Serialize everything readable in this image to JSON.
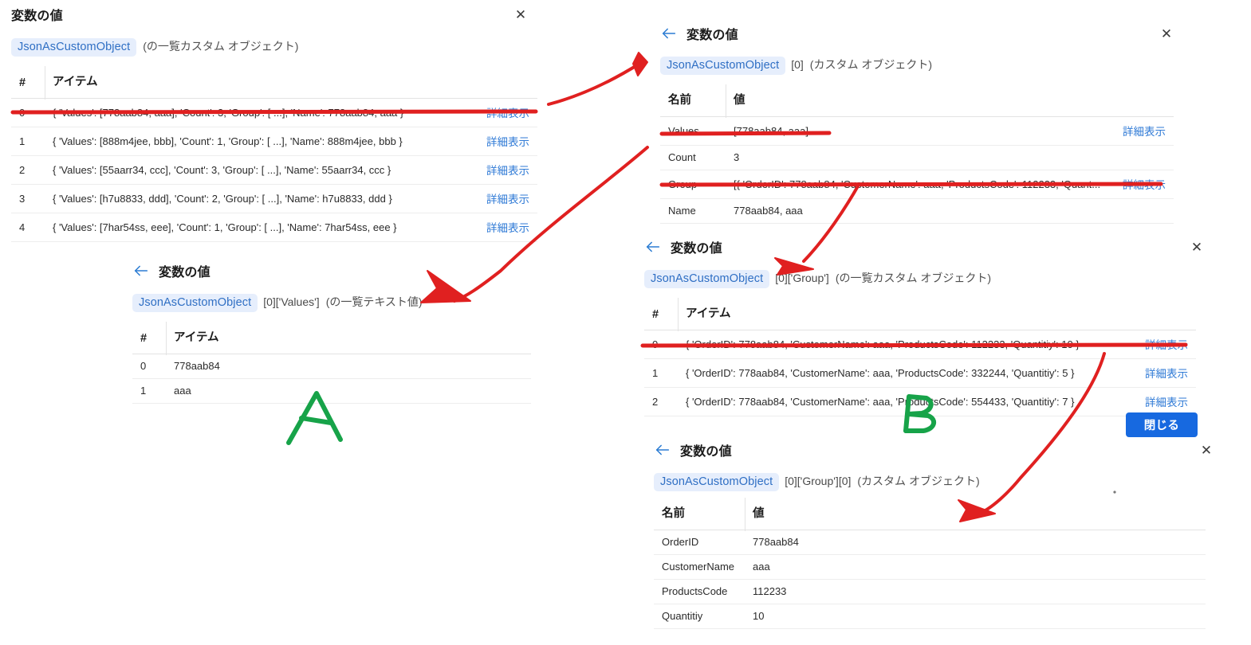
{
  "common": {
    "title": "変数の値",
    "detail_link": "詳細表示",
    "col_index": "#",
    "col_item": "アイテム",
    "col_name": "名前",
    "col_value": "値",
    "close_icon": "✕",
    "back_icon": "back-arrow-icon",
    "accent_blue": "#2f7ad6",
    "pill_bg": "#e6eefc",
    "pill_text": "#2f6fc4",
    "button_blue": "#1769e0",
    "annotation_red": "#e02020",
    "annotation_green": "#17a349"
  },
  "panel1": {
    "title": "変数の値",
    "variable": "JsonAsCustomObject",
    "path": "",
    "type_note": "(の一覧カスタム オブジェクト)",
    "headers": {
      "index": "#",
      "item": "アイテム"
    },
    "rows": [
      {
        "index": "0",
        "item": "{ 'Values': [778aab84, aaa], 'Count': 3, 'Group': [ ...], 'Name': 778aab84, aaa }",
        "link": "詳細表示"
      },
      {
        "index": "1",
        "item": "{ 'Values': [888m4jee, bbb], 'Count': 1, 'Group': [ ...], 'Name': 888m4jee, bbb }",
        "link": "詳細表示"
      },
      {
        "index": "2",
        "item": "{ 'Values': [55aarr34, ccc], 'Count': 3, 'Group': [ ...], 'Name': 55aarr34, ccc }",
        "link": "詳細表示"
      },
      {
        "index": "3",
        "item": "{ 'Values': [h7u8833, ddd], 'Count': 2, 'Group': [ ...], 'Name': h7u8833, ddd }",
        "link": "詳細表示"
      },
      {
        "index": "4",
        "item": "{ 'Values': [7har54ss, eee], 'Count': 1, 'Group': [ ...], 'Name': 7har54ss, eee }",
        "link": "詳細表示"
      }
    ]
  },
  "panel2": {
    "title": "変数の値",
    "variable": "JsonAsCustomObject",
    "path": "[0]",
    "type_note": "(カスタム オブジェクト)",
    "headers": {
      "name": "名前",
      "value": "値"
    },
    "rows": [
      {
        "name": "Values",
        "value": "[778aab84, aaa]",
        "link": "詳細表示"
      },
      {
        "name": "Count",
        "value": "3",
        "link": ""
      },
      {
        "name": "Group",
        "value": "[{ 'OrderID': 778aab84, 'CustomerName': aaa, 'ProductsCode': 112233, 'Quant...",
        "link": "詳細表示"
      },
      {
        "name": "Name",
        "value": "778aab84, aaa",
        "link": ""
      }
    ]
  },
  "panel3": {
    "title": "変数の値",
    "variable": "JsonAsCustomObject",
    "path": "[0]['Values']",
    "type_note": "(の一覧テキスト値)",
    "headers": {
      "index": "#",
      "item": "アイテム"
    },
    "rows": [
      {
        "index": "0",
        "item": "778aab84"
      },
      {
        "index": "1",
        "item": "aaa"
      }
    ]
  },
  "panel4": {
    "title": "変数の値",
    "variable": "JsonAsCustomObject",
    "path": "[0]['Group']",
    "type_note": "(の一覧カスタム オブジェクト)",
    "headers": {
      "index": "#",
      "item": "アイテム"
    },
    "rows": [
      {
        "index": "0",
        "item": "{ 'OrderID': 778aab84, 'CustomerName': aaa, 'ProductsCode': 112233, 'Quantitiy': 10 }",
        "link": "詳細表示"
      },
      {
        "index": "1",
        "item": "{ 'OrderID': 778aab84, 'CustomerName': aaa, 'ProductsCode': 332244, 'Quantitiy': 5 }",
        "link": "詳細表示"
      },
      {
        "index": "2",
        "item": "{ 'OrderID': 778aab84, 'CustomerName': aaa, 'ProductsCode': 554433, 'Quantitiy': 7 }",
        "link": "詳細表示"
      }
    ],
    "close_button": "閉じる"
  },
  "panel5": {
    "title": "変数の値",
    "variable": "JsonAsCustomObject",
    "path": "[0]['Group'][0]",
    "type_note": "(カスタム オブジェクト)",
    "headers": {
      "name": "名前",
      "value": "値"
    },
    "rows": [
      {
        "name": "OrderID",
        "value": "778aab84"
      },
      {
        "name": "CustomerName",
        "value": "aaa"
      },
      {
        "name": "ProductsCode",
        "value": "112233"
      },
      {
        "name": "Quantitiy",
        "value": "10"
      }
    ]
  },
  "annotations": {
    "label_a": "A",
    "label_b": "B"
  }
}
